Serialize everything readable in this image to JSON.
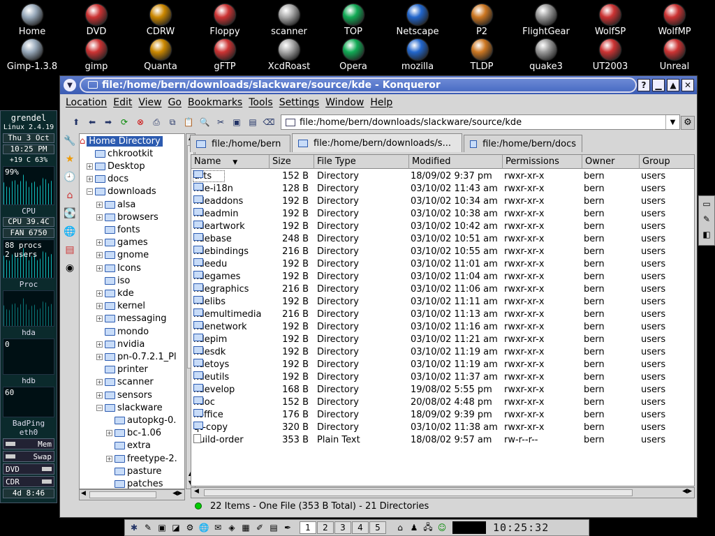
{
  "desktop": {
    "row1": [
      "Home",
      "DVD",
      "CDRW",
      "Floppy",
      "scanner",
      "TOP",
      "Netscape",
      "P2",
      "FlightGear",
      "WolfSP",
      "WolfMP"
    ],
    "row2": [
      "Gimp-1.3.8",
      "gimp",
      "Quanta",
      "gFTP",
      "XcdRoast",
      "Opera",
      "mozilla",
      "TLDP",
      "quake3",
      "UT2003",
      "Unreal"
    ]
  },
  "gkrellm": {
    "hostname": "grendel",
    "kernel": "Linux 2.4.19",
    "date": "Thu  3 Oct",
    "time": "10:25 PM",
    "temps": "+19 C 63%",
    "cpu_pct": "99%",
    "cpu_label": "CPU",
    "cpu_temp": "CPU  39.4C",
    "fan": "FAN  6750",
    "procs": "88 procs",
    "users": "2 users",
    "proc_label": "Proc",
    "hda_val": "0",
    "hda_label": "hda",
    "hdb_val": "0",
    "hdb_label": "hdb",
    "ping_val": "60",
    "ping_label": "BadPing",
    "eth_label": "eth0",
    "mem_label": "Mem",
    "swap_label": "Swap",
    "dvd_label": "DVD",
    "cdr_label": "CDR",
    "uptime": "4d  8:46"
  },
  "window": {
    "title": "file:/home/bern/downloads/slackware/source/kde - Konqueror",
    "menu": [
      "Location",
      "Edit",
      "View",
      "Go",
      "Bookmarks",
      "Tools",
      "Settings",
      "Window",
      "Help"
    ],
    "location": "file:/home/bern/downloads/slackware/source/kde",
    "tabs": [
      "file:/home/bern",
      "file:/home/bern/downloads/s...",
      "file:/home/bern/docs"
    ],
    "tree": [
      "Home Directory",
      "chkrootkit",
      "Desktop",
      "docs",
      "downloads",
      "alsa",
      "browsers",
      "fonts",
      "games",
      "gnome",
      "Icons",
      "iso",
      "kde",
      "kernel",
      "messaging",
      "mondo",
      "nvidia",
      "pn-0.7.2.1_Pl",
      "printer",
      "scanner",
      "sensors",
      "slackware",
      "autopkg-0.",
      "bc-1.06",
      "extra",
      "freetype-2.",
      "pasture",
      "patches"
    ],
    "columns": [
      "Name",
      "Size",
      "File Type",
      "Modified",
      "Permissions",
      "Owner",
      "Group"
    ],
    "rows": [
      [
        "arts",
        "152 B",
        "Directory",
        "18/09/02 9:37 pm",
        "rwxr-xr-x",
        "bern",
        "users"
      ],
      [
        "kde-i18n",
        "128 B",
        "Directory",
        "03/10/02 11:43 am",
        "rwxr-xr-x",
        "bern",
        "users"
      ],
      [
        "kdeaddons",
        "192 B",
        "Directory",
        "03/10/02 10:34 am",
        "rwxr-xr-x",
        "bern",
        "users"
      ],
      [
        "kdeadmin",
        "192 B",
        "Directory",
        "03/10/02 10:38 am",
        "rwxr-xr-x",
        "bern",
        "users"
      ],
      [
        "kdeartwork",
        "192 B",
        "Directory",
        "03/10/02 10:42 am",
        "rwxr-xr-x",
        "bern",
        "users"
      ],
      [
        "kdebase",
        "248 B",
        "Directory",
        "03/10/02 10:51 am",
        "rwxr-xr-x",
        "bern",
        "users"
      ],
      [
        "kdebindings",
        "216 B",
        "Directory",
        "03/10/02 10:55 am",
        "rwxr-xr-x",
        "bern",
        "users"
      ],
      [
        "kdeedu",
        "192 B",
        "Directory",
        "03/10/02 11:01 am",
        "rwxr-xr-x",
        "bern",
        "users"
      ],
      [
        "kdegames",
        "192 B",
        "Directory",
        "03/10/02 11:04 am",
        "rwxr-xr-x",
        "bern",
        "users"
      ],
      [
        "kdegraphics",
        "216 B",
        "Directory",
        "03/10/02 11:06 am",
        "rwxr-xr-x",
        "bern",
        "users"
      ],
      [
        "kdelibs",
        "192 B",
        "Directory",
        "03/10/02 11:11 am",
        "rwxr-xr-x",
        "bern",
        "users"
      ],
      [
        "kdemultimedia",
        "216 B",
        "Directory",
        "03/10/02 11:13 am",
        "rwxr-xr-x",
        "bern",
        "users"
      ],
      [
        "kdenetwork",
        "192 B",
        "Directory",
        "03/10/02 11:16 am",
        "rwxr-xr-x",
        "bern",
        "users"
      ],
      [
        "kdepim",
        "192 B",
        "Directory",
        "03/10/02 11:21 am",
        "rwxr-xr-x",
        "bern",
        "users"
      ],
      [
        "kdesdk",
        "192 B",
        "Directory",
        "03/10/02 11:19 am",
        "rwxr-xr-x",
        "bern",
        "users"
      ],
      [
        "kdetoys",
        "192 B",
        "Directory",
        "03/10/02 11:19 am",
        "rwxr-xr-x",
        "bern",
        "users"
      ],
      [
        "kdeutils",
        "192 B",
        "Directory",
        "03/10/02 11:37 am",
        "rwxr-xr-x",
        "bern",
        "users"
      ],
      [
        "kdevelop",
        "168 B",
        "Directory",
        "19/08/02 5:55 pm",
        "rwxr-xr-x",
        "bern",
        "users"
      ],
      [
        "kdoc",
        "152 B",
        "Directory",
        "20/08/02 4:48 pm",
        "rwxr-xr-x",
        "bern",
        "users"
      ],
      [
        "koffice",
        "176 B",
        "Directory",
        "18/09/02 9:39 pm",
        "rwxr-xr-x",
        "bern",
        "users"
      ],
      [
        "qt-copy",
        "320 B",
        "Directory",
        "03/10/02 11:38 am",
        "rwxr-xr-x",
        "bern",
        "users"
      ],
      [
        "build-order",
        "353 B",
        "Plain Text",
        "18/08/02 9:57 am",
        "rw-r--r--",
        "bern",
        "users"
      ]
    ],
    "status": "22 Items - One File (353 B Total) - 21 Directories"
  },
  "taskbar": {
    "desktops": [
      "1",
      "2",
      "3",
      "4",
      "5"
    ],
    "clock": "10:25:32"
  }
}
